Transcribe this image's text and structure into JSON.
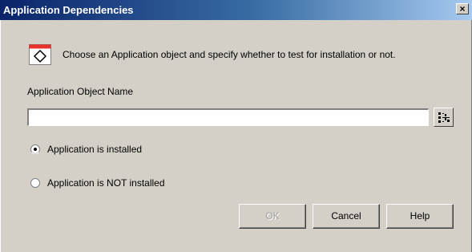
{
  "window": {
    "title": "Application Dependencies",
    "close_glyph": "×"
  },
  "header": {
    "icon": "application-object-icon",
    "text": "Choose an Application object and specify whether to test for installation or not."
  },
  "field": {
    "label": "Application Object Name",
    "value": "",
    "browse_icon": "browse-tree-icon"
  },
  "radios": [
    {
      "label": "Application is installed",
      "checked": true
    },
    {
      "label": "Application is NOT installed",
      "checked": false
    }
  ],
  "buttons": {
    "ok": "OK",
    "cancel": "Cancel",
    "help": "Help"
  },
  "colors": {
    "titlebar_start": "#0a246a",
    "titlebar_end": "#a6caf0",
    "dialog_bg": "#d4d0c8",
    "icon_accent": "#e8332a"
  }
}
